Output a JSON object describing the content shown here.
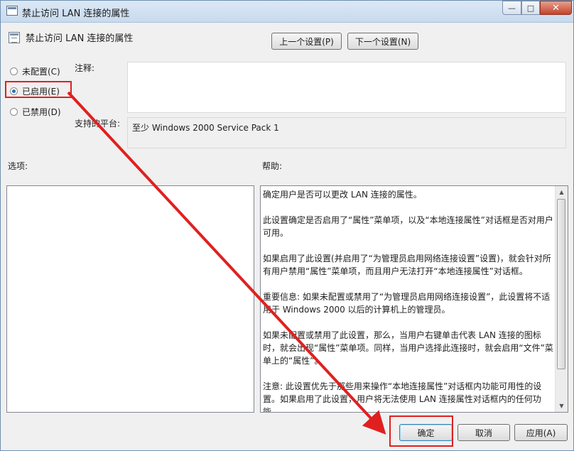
{
  "window": {
    "title": "禁止访问 LAN 连接的属性",
    "controls": {
      "minimize": "—",
      "maximize": "□",
      "close": "✕"
    }
  },
  "policy": {
    "name": "禁止访问 LAN 连接的属性"
  },
  "nav": {
    "prev_label": "上一个设置(P)",
    "next_label": "下一个设置(N)"
  },
  "state_options": [
    {
      "label": "未配置(C)",
      "selected": false
    },
    {
      "label": "已启用(E)",
      "selected": true
    },
    {
      "label": "已禁用(D)",
      "selected": false
    }
  ],
  "comment": {
    "label": "注释:",
    "value": ""
  },
  "platform": {
    "label": "支持的平台:",
    "value": "至少 Windows 2000 Service Pack 1"
  },
  "options": {
    "label": "选项:"
  },
  "help": {
    "label": "帮助:",
    "paragraphs": [
      "确定用户是否可以更改 LAN 连接的属性。",
      "此设置确定是否启用了“属性”菜单项，以及“本地连接属性”对话框是否对用户可用。",
      "如果启用了此设置(并启用了“为管理员启用网络连接设置”设置)，就会针对所有用户禁用“属性”菜单项，而且用户无法打开“本地连接属性”对话框。",
      "重要信息: 如果未配置或禁用了“为管理员启用网络连接设置”，此设置将不适用于 Windows 2000 以后的计算机上的管理员。",
      "如果未配置或禁用了此设置，那么，当用户右键单击代表 LAN 连接的图标时，就会出现“属性”菜单项。同样，当用户选择此连接时，就会启用“文件”菜单上的“属性”。",
      "注意: 此设置优先于那些用来操作“本地连接属性”对话框内功能可用性的设置。如果启用了此设置，用户将无法使用 LAN 连接属性对话框内的任何功能。"
    ]
  },
  "footer": {
    "ok_label": "确定",
    "cancel_label": "取消",
    "apply_label": "应用(A)"
  },
  "annotation": {
    "color": "#e02020"
  }
}
